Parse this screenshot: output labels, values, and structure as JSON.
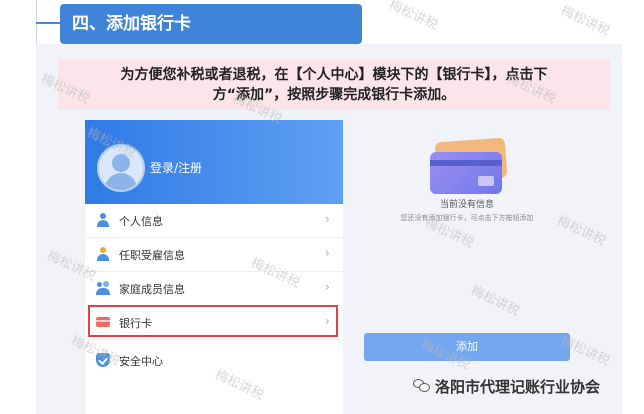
{
  "section": {
    "title": "四、添加银行卡"
  },
  "instruction": {
    "line1": "为方便您补税或者退税，在【个人中心】模块下的【银行卡】，点击下",
    "line2": "方“添加”，按照步骤完成银行卡添加。"
  },
  "app": {
    "login_label": "登录/注册",
    "menu": [
      {
        "label": "个人信息",
        "icon": "person-icon"
      },
      {
        "label": "任职受雇信息",
        "icon": "employment-icon"
      },
      {
        "label": "家庭成员信息",
        "icon": "family-icon"
      },
      {
        "label": "银行卡",
        "icon": "bank-card-icon"
      },
      {
        "label": "安全中心",
        "icon": "shield-icon"
      }
    ],
    "chevron": "›"
  },
  "empty_state": {
    "title": "当前没有信息",
    "hint": "您还没有添加银行卡，可点击下方按钮添加"
  },
  "add_button": "添加",
  "footer": {
    "brand": "洛阳市代理记账行业协会"
  },
  "watermark": "梅松讲税",
  "colors": {
    "header_blue": "#3f84d8",
    "instruction_bg": "#fbe5ea",
    "highlight_red": "#e0414b",
    "add_button": "#72a6ef"
  }
}
